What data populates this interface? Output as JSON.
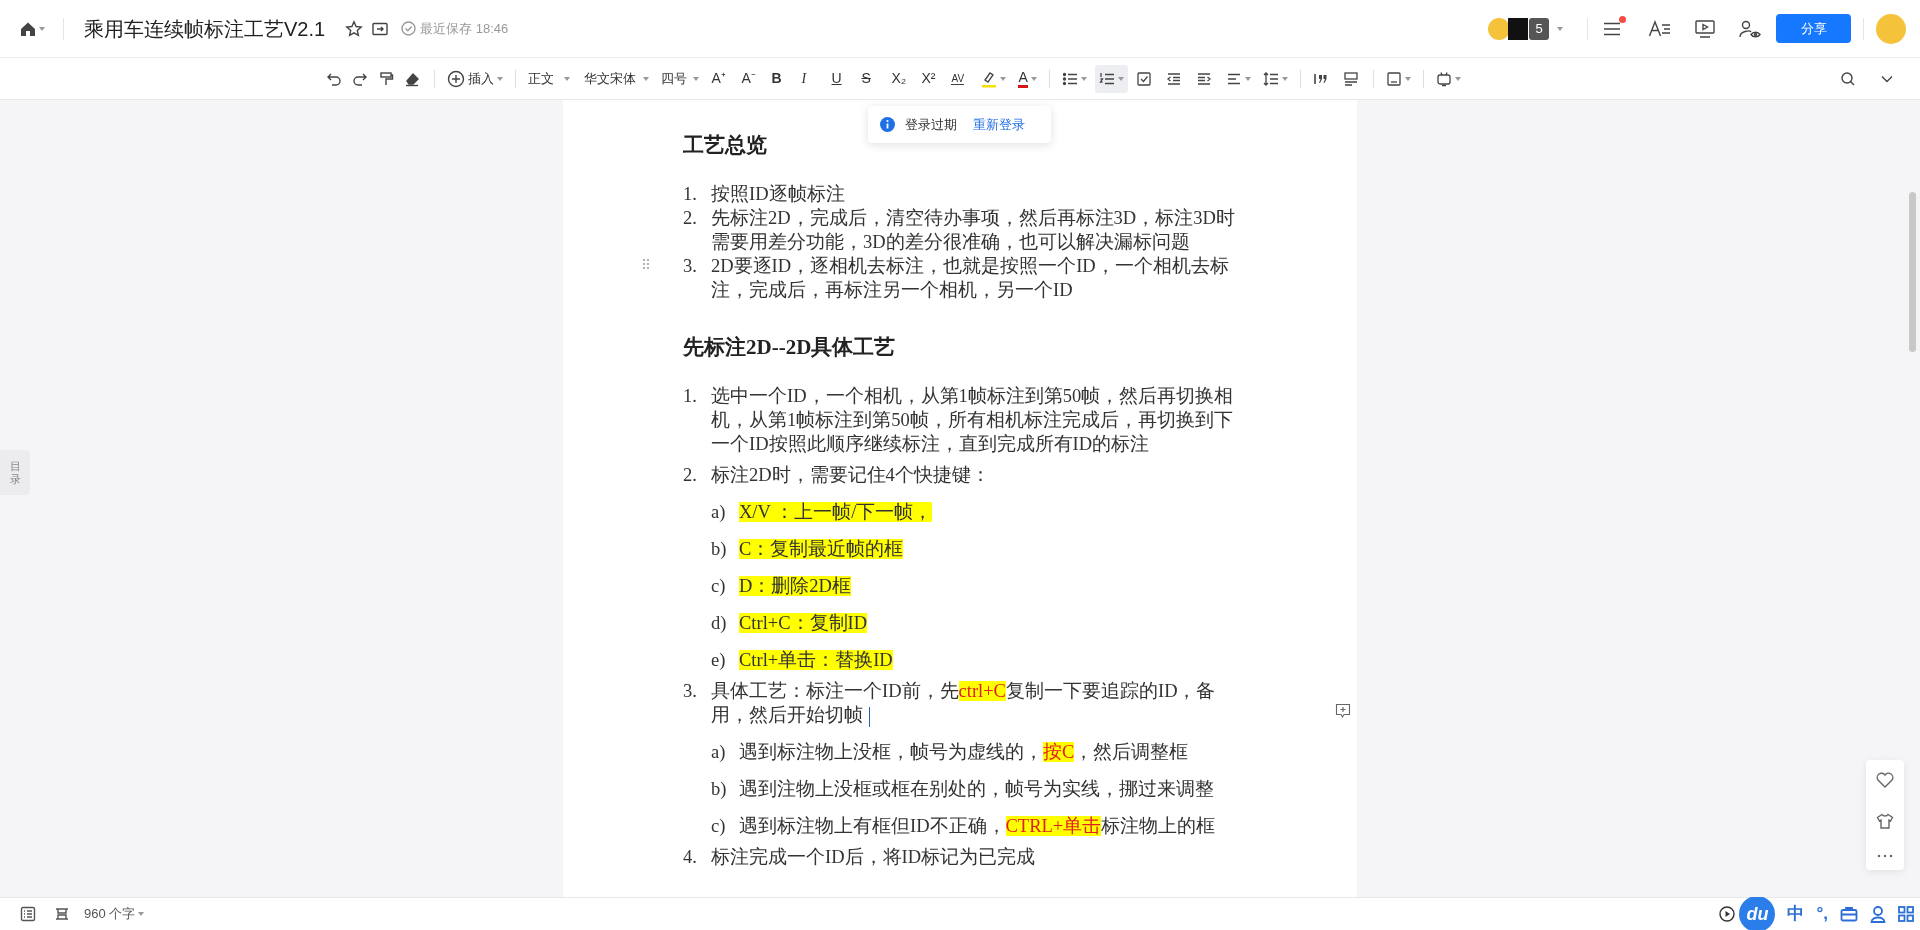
{
  "app_bar": {
    "title": "乘用车连续帧标注工艺V2.1",
    "save_status": "最近保存 18:46",
    "collaborator_count": "5",
    "share_button": "分享",
    "has_notification": true
  },
  "toolbar": {
    "insert": "插入",
    "style": "正文",
    "font": "华文宋体",
    "size": "四号",
    "format_buttons": [
      {
        "label": "A⁺",
        "kind": "grow"
      },
      {
        "label": "A⁻",
        "kind": "shrink"
      },
      {
        "label": "B",
        "kind": "bold"
      },
      {
        "label": "I",
        "kind": "italic"
      },
      {
        "label": "U",
        "kind": "underline"
      },
      {
        "label": "S",
        "kind": "strike"
      },
      {
        "label": "X₂",
        "kind": "sub"
      },
      {
        "label": "X²",
        "kind": "sup"
      },
      {
        "label": "AV",
        "kind": "spacing"
      }
    ],
    "font_color_label": "A",
    "numbered_list_active": true
  },
  "login_notice": {
    "message": "登录过期",
    "action": "重新登录"
  },
  "outline_tab": "目录",
  "document": {
    "blocks": [
      {
        "kind": "heading",
        "text": "工艺总览"
      },
      {
        "kind": "item",
        "hovered": false,
        "caret": false,
        "number": "1.",
        "runs": [
          {
            "text": "按照ID逐帧标注",
            "highlight": false,
            "red": false
          }
        ]
      },
      {
        "kind": "item",
        "hovered": false,
        "caret": false,
        "number": "2.",
        "runs": [
          {
            "text": "先标注2D，完成后，清空待办事项，然后再标注3D，标注3D时需要用差分功能，3D的差分很准确，也可以解决漏标问题",
            "highlight": false,
            "red": false
          }
        ]
      },
      {
        "kind": "item",
        "hovered": true,
        "caret": false,
        "number": "3.",
        "runs": [
          {
            "text": "2D要逐ID，逐相机去标注，也就是按照一个ID，一个相机去标注，完成后，再标注另一个相机，另一个ID",
            "highlight": false,
            "red": false
          }
        ]
      },
      {
        "kind": "heading",
        "text": "先标注2D--2D具体工艺"
      },
      {
        "kind": "item",
        "hovered": false,
        "caret": false,
        "number": "1.",
        "runs": [
          {
            "text": "选中一个ID，一个相机，从第1帧标注到第50帧，然后再切换相机，从第1帧标注到第50帧，所有相机标注完成后，再切换到下一个ID按照此顺序继续标注，直到完成所有ID的标注",
            "highlight": false,
            "red": false
          }
        ]
      },
      {
        "kind": "item",
        "hovered": false,
        "caret": false,
        "number": "2.",
        "runs": [
          {
            "text": "标注2D时，需要记住4个快捷键：",
            "highlight": false,
            "red": false
          }
        ]
      },
      {
        "kind": "subitem",
        "hovered": false,
        "caret": false,
        "number": "a)",
        "runs": [
          {
            "text": "X/V ：上一帧/下一帧，",
            "highlight": true,
            "red": false
          }
        ]
      },
      {
        "kind": "subitem",
        "hovered": false,
        "caret": false,
        "number": "b)",
        "runs": [
          {
            "text": "C：复制最近帧的框",
            "highlight": true,
            "red": false
          }
        ]
      },
      {
        "kind": "subitem",
        "hovered": false,
        "caret": false,
        "number": "c)",
        "runs": [
          {
            "text": "D：删除2D框",
            "highlight": true,
            "red": false
          }
        ]
      },
      {
        "kind": "subitem",
        "hovered": false,
        "caret": false,
        "number": "d)",
        "runs": [
          {
            "text": "Ctrl+C：复制ID",
            "highlight": true,
            "red": false
          }
        ]
      },
      {
        "kind": "subitem",
        "hovered": false,
        "caret": false,
        "number": "e)",
        "runs": [
          {
            "text": "Ctrl+单击：替换ID",
            "highlight": true,
            "red": false
          }
        ]
      },
      {
        "kind": "item",
        "hovered": false,
        "caret": true,
        "number": "3.",
        "runs": [
          {
            "text": "具体工艺：标注一个ID前，先",
            "highlight": false,
            "red": false
          },
          {
            "text": "ctrl+C",
            "highlight": true,
            "red": true
          },
          {
            "text": "复制一下要追踪的ID，备用，然后开始切帧",
            "highlight": false,
            "red": false
          }
        ]
      },
      {
        "kind": "subitem",
        "hovered": false,
        "caret": false,
        "number": "a)",
        "runs": [
          {
            "text": "遇到标注物上没框，帧号为虚线的，",
            "highlight": false,
            "red": false
          },
          {
            "text": "按C",
            "highlight": true,
            "red": true
          },
          {
            "text": "，然后调整框",
            "highlight": false,
            "red": false
          }
        ]
      },
      {
        "kind": "subitem",
        "hovered": false,
        "caret": false,
        "number": "b)",
        "runs": [
          {
            "text": "遇到注物上没框或框在别处的，帧号为实线，挪过来调整",
            "highlight": false,
            "red": false
          }
        ]
      },
      {
        "kind": "subitem",
        "hovered": false,
        "caret": false,
        "number": "c)",
        "runs": [
          {
            "text": "遇到标注物上有框但ID不正确，",
            "highlight": false,
            "red": false
          },
          {
            "text": "CTRL+单击",
            "highlight": true,
            "red": true
          },
          {
            "text": "标注物上的框",
            "highlight": false,
            "red": false
          }
        ]
      },
      {
        "kind": "item",
        "hovered": false,
        "caret": false,
        "number": "4.",
        "runs": [
          {
            "text": "标注完成一个ID后，将ID标记为已完成",
            "highlight": false,
            "red": false
          }
        ]
      }
    ]
  },
  "status_bar": {
    "word_count": "960 个字"
  },
  "ime": {
    "logo": "du",
    "mode": "中",
    "punctuation": "°,"
  }
}
